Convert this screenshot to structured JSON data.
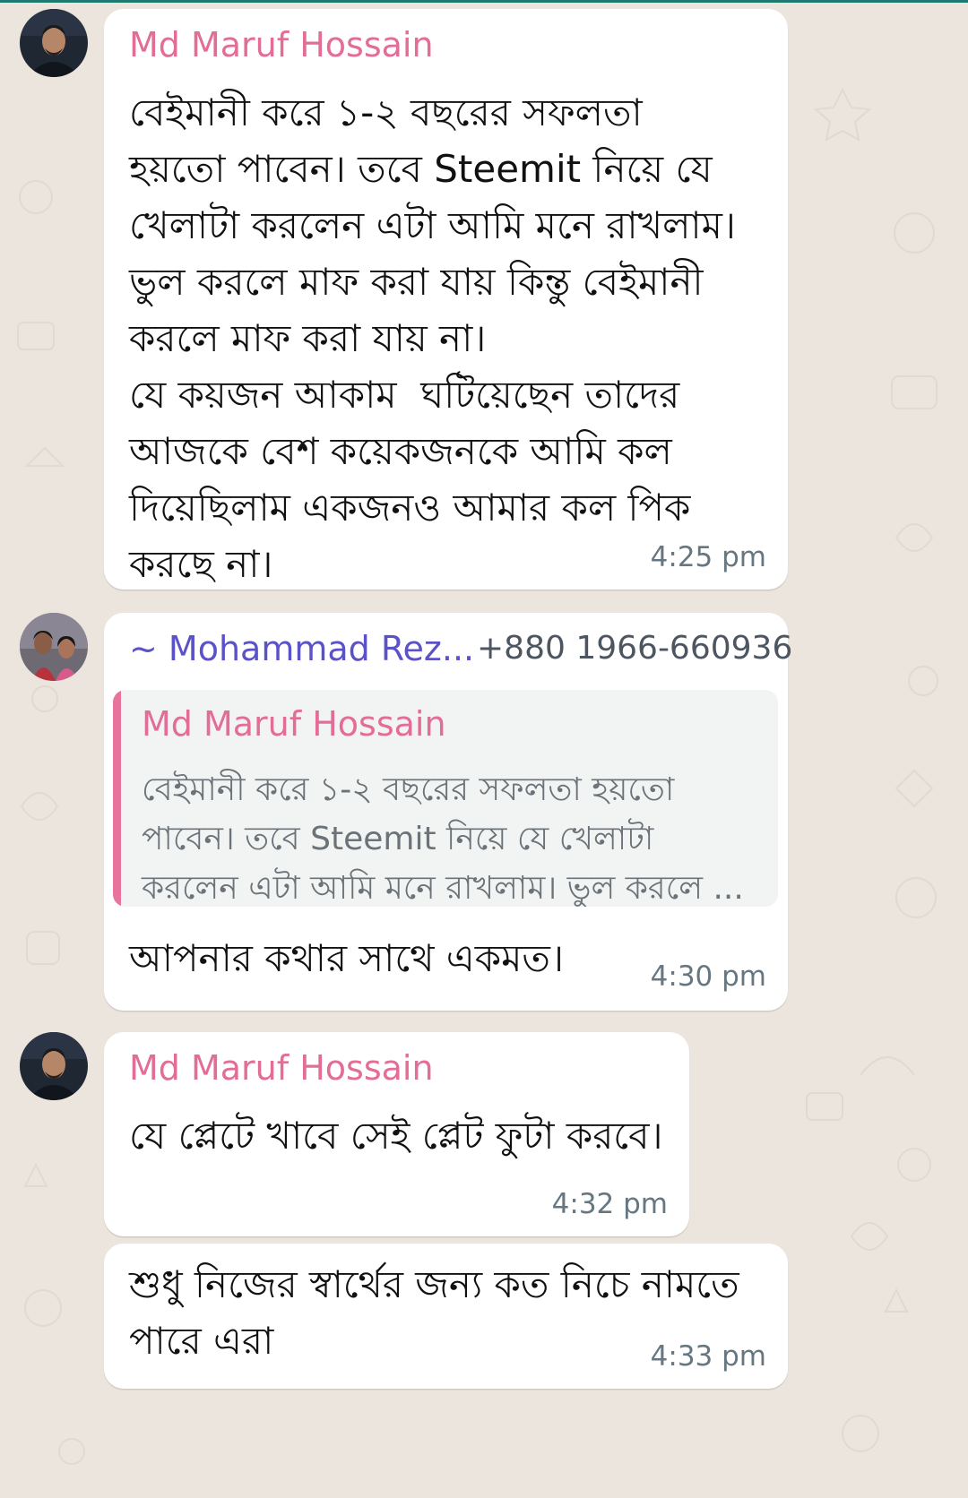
{
  "theme": {
    "alice_name_color": "#e26d97",
    "bob_name_color": "#5b52c8",
    "quote_bar_color": "#e8739d",
    "bubble_color": "#ffffff",
    "wallpaper_color": "#ece5dd"
  },
  "messages": [
    {
      "sender": "Md Maruf Hossain",
      "text": "বেইমানী করে ১-২ বছরের সফলতা\nহয়তো পাবেন। তবে Steemit নিয়ে যে\nখেলাটা করলেন এটা আমি মনে রাখলাম।\nভুল করলে মাফ করা যায় কিন্তু বেইমানী\nকরলে মাফ করা যায় না।\nযে কয়জন আকাম  ঘটিয়েছেন তাদের\nআজকে বেশ কয়েকজনকে আমি কল\nদিয়েছিলাম একজনও আমার কল পিক\nকরছে না।",
      "time": "4:25 pm"
    },
    {
      "sender": "~ Mohammad Rez...",
      "phone": "+880 1966-660936",
      "quote": {
        "sender": "Md Maruf Hossain",
        "text": "বেইমানী করে ১-২ বছরের সফলতা হয়তো\nপাবেন। তবে Steemit নিয়ে যে খেলাটা\nকরলেন এটা আমি মনে রাখলাম। ভুল করলে ..."
      },
      "text": "আপনার কথার সাথে একমত।",
      "time": "4:30 pm"
    },
    {
      "sender": "Md Maruf Hossain",
      "text": "যে প্লেটে খাবে সেই প্লেট ফুটা করবে।",
      "time": "4:32 pm"
    },
    {
      "text": "শুধু নিজের স্বার্থের জন্য কত নিচে নামতে\nপারে এরা",
      "time": "4:33 pm"
    }
  ]
}
